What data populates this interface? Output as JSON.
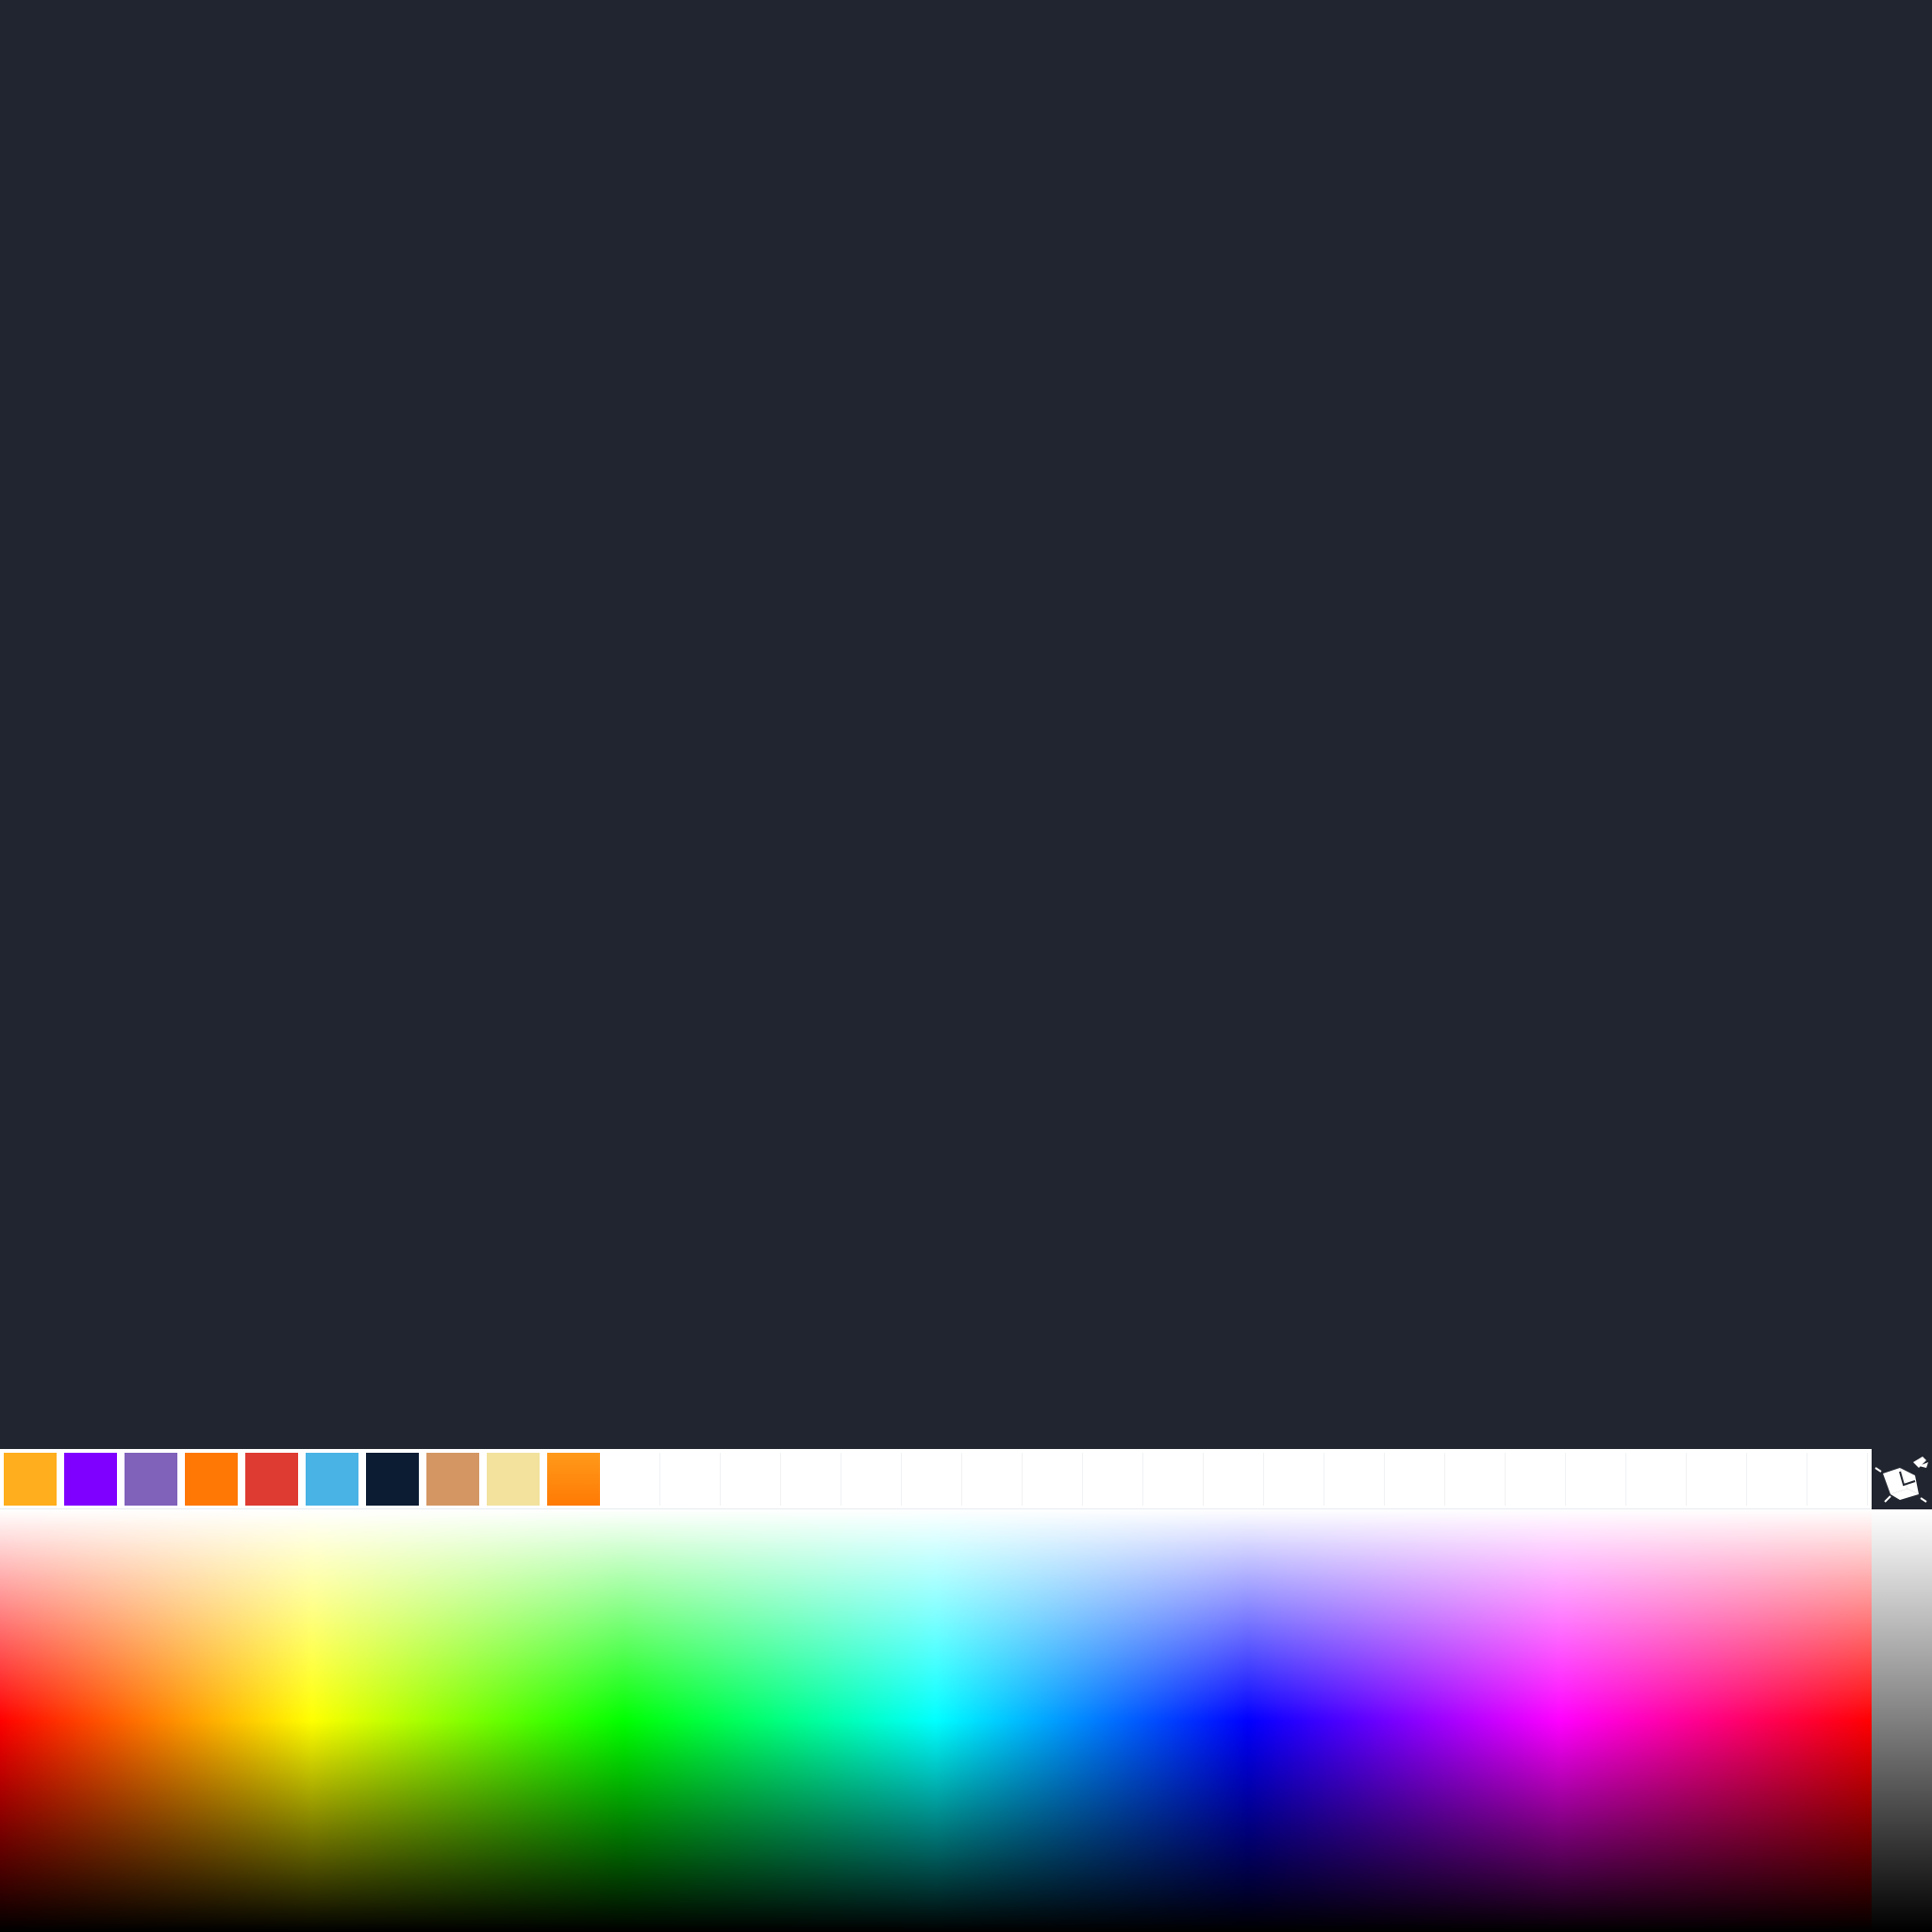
{
  "palette": {
    "swatches": [
      {
        "name": "swatch-amber",
        "color": "#ffae1e"
      },
      {
        "name": "swatch-violet",
        "color": "#7f00ff"
      },
      {
        "name": "swatch-lavender",
        "color": "#8062bb"
      },
      {
        "name": "swatch-orange",
        "color": "#ff7806"
      },
      {
        "name": "swatch-red",
        "color": "#de3b32"
      },
      {
        "name": "swatch-sky-blue",
        "color": "#4ab3e5"
      },
      {
        "name": "swatch-navy",
        "color": "#0b1c33"
      },
      {
        "name": "swatch-tan",
        "color": "#d49764"
      },
      {
        "name": "swatch-pale-yellow",
        "color": "#f2e29e"
      },
      {
        "name": "swatch-orange-gradient",
        "color": "#ff8c0f"
      }
    ],
    "empty_slots": 21
  },
  "colors": {
    "background": "#21252f",
    "palette_bg": "#ffffff",
    "logo_bg": "#21252f"
  },
  "logo": {
    "icon": "paint-bucket-splash-icon"
  }
}
